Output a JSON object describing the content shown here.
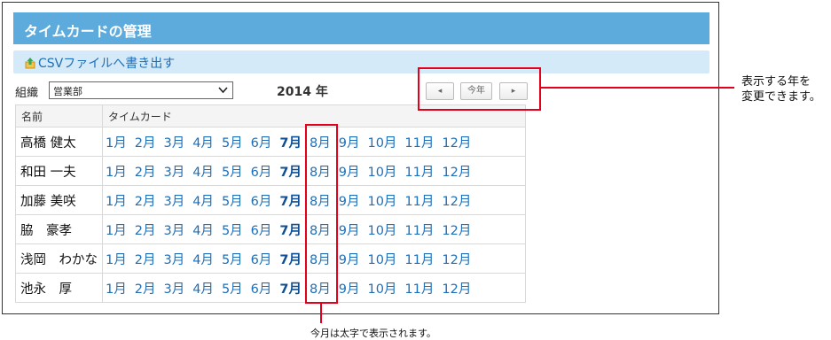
{
  "header": {
    "title": "タイムカードの管理"
  },
  "csv_export": {
    "label": "CSVファイルへ書き出す",
    "icon": "upload-file-icon"
  },
  "org_filter": {
    "label": "組織",
    "selected": "営業部"
  },
  "year_label": "2014 年",
  "nav": {
    "prev": "◂",
    "current": "今年",
    "next": "▸"
  },
  "table": {
    "headers": {
      "name": "名前",
      "timecard": "タイムカード"
    },
    "months": [
      "1月",
      "2月",
      "3月",
      "4月",
      "5月",
      "6月",
      "7月",
      "8月",
      "9月",
      "10月",
      "11月",
      "12月"
    ],
    "current_month": "7月",
    "rows": [
      {
        "name": "高橋 健太"
      },
      {
        "name": "和田 一夫"
      },
      {
        "name": "加藤 美咲"
      },
      {
        "name": "脇　豪孝"
      },
      {
        "name": "浅岡　わかな"
      },
      {
        "name": "池永　厚"
      }
    ]
  },
  "annotations": {
    "year_change": [
      "表示する年を",
      "変更できます。"
    ],
    "current_month": "今月は太字で表示されます。"
  },
  "colors": {
    "title_bg": "#5dabdc",
    "csv_bg": "#d4eaf8",
    "link": "#1e6fb8",
    "highlight": "#e3001b"
  }
}
